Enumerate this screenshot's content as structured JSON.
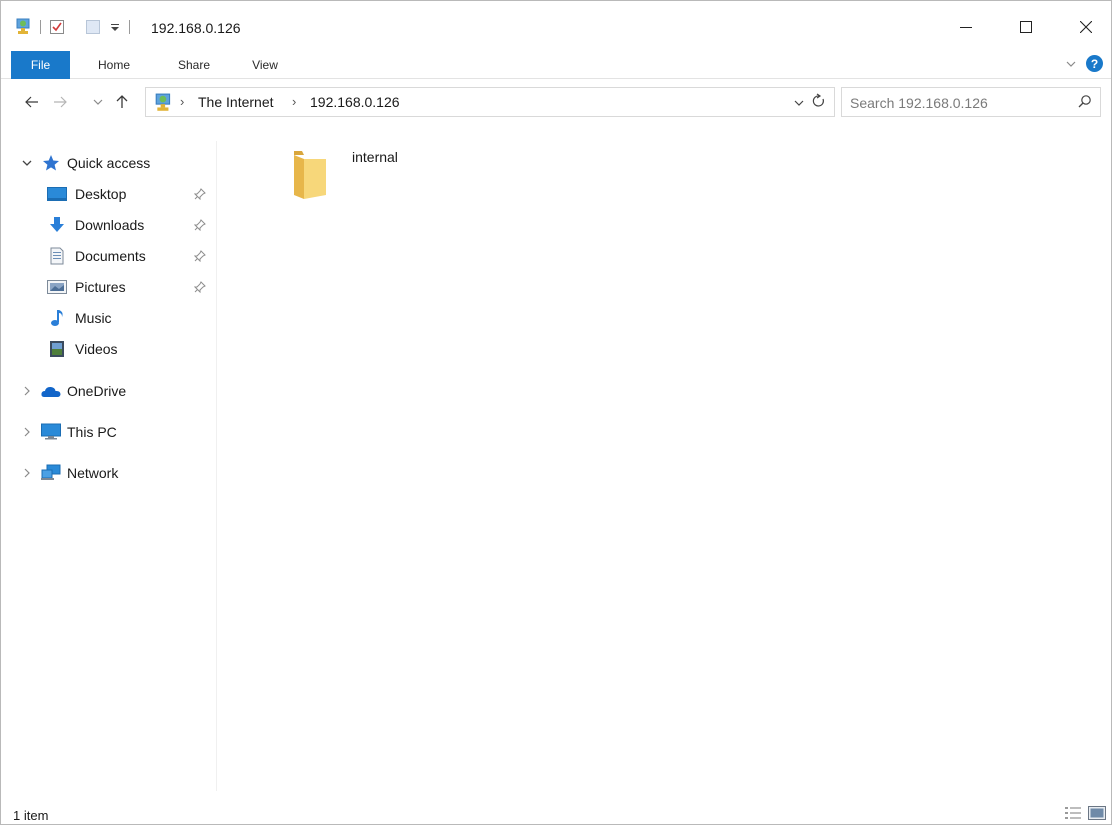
{
  "window": {
    "title": "192.168.0.126",
    "controls": {
      "minimize": "minimize-icon",
      "maximize": "maximize-icon",
      "close": "close-icon"
    }
  },
  "ribbon": {
    "tabs": [
      "File",
      "Home",
      "Share",
      "View"
    ]
  },
  "address": {
    "breadcrumbs": [
      "The Internet",
      "192.168.0.126"
    ],
    "search_placeholder": "Search 192.168.0.126"
  },
  "nav": {
    "quick_access": "Quick access",
    "quick_items": [
      "Desktop",
      "Downloads",
      "Documents",
      "Pictures",
      "Music",
      "Videos"
    ],
    "onedrive": "OneDrive",
    "this_pc": "This PC",
    "network": "Network"
  },
  "content": {
    "items": [
      {
        "name": "internal",
        "type": "folder"
      }
    ]
  },
  "status": {
    "count": "1 item"
  },
  "colors": {
    "accent": "#1979ca",
    "folder": "#f3cf6a",
    "star": "#2f74d0"
  }
}
